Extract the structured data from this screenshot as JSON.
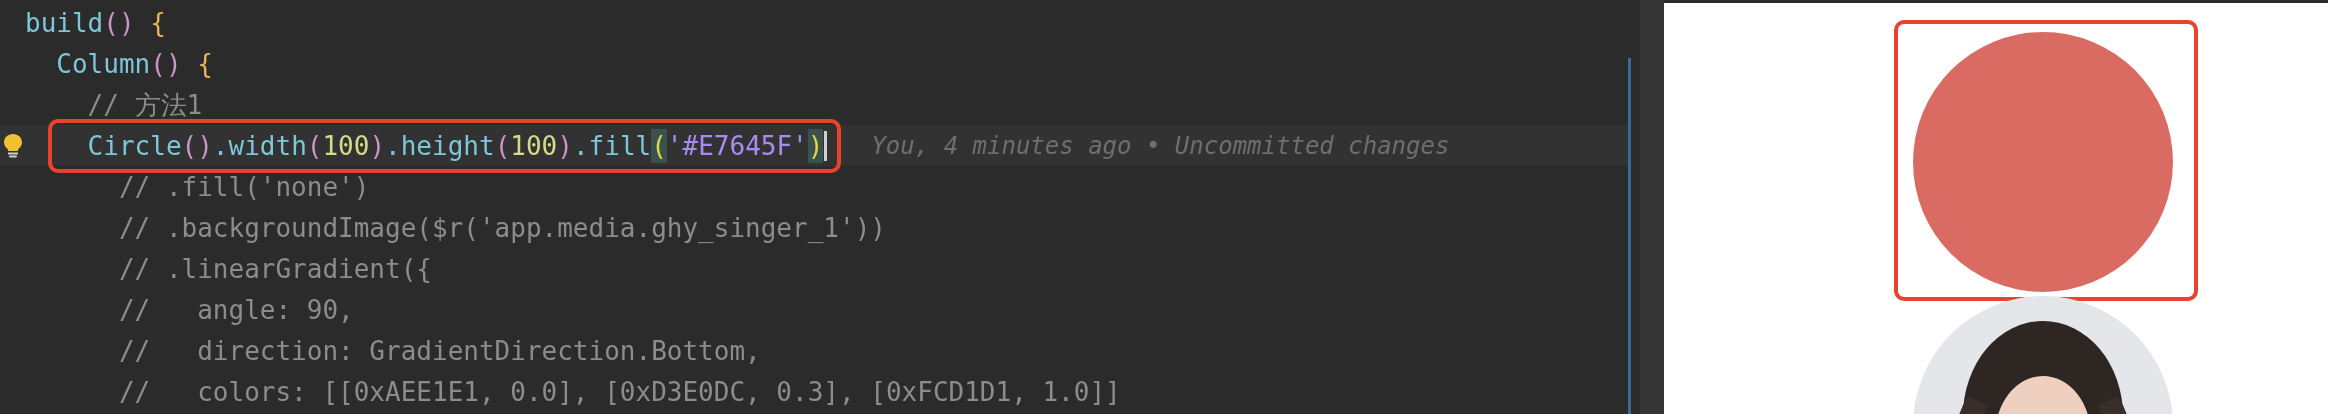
{
  "editor": {
    "lines": [
      {
        "current": false,
        "marked": false,
        "tokens": [
          {
            "kind": "ident",
            "text": "build"
          },
          {
            "kind": "paren",
            "text": "()"
          },
          {
            "kind": "brace",
            "text": " {"
          }
        ]
      },
      {
        "current": false,
        "marked": false,
        "tokens": [
          {
            "kind": "ident",
            "text": "  Column"
          },
          {
            "kind": "paren",
            "text": "()"
          },
          {
            "kind": "brace",
            "text": " {"
          }
        ]
      },
      {
        "current": false,
        "marked": false,
        "tokens": [
          {
            "kind": "comment",
            "text": "    // 方法1"
          }
        ]
      },
      {
        "current": true,
        "marked": true,
        "blame": "You, 4 minutes ago • Uncommitted changes",
        "tokens": [
          {
            "kind": "ident",
            "text": "    Circle"
          },
          {
            "kind": "paren",
            "text": "()"
          },
          {
            "kind": "ident",
            "text": ".width"
          },
          {
            "kind": "paren",
            "text": "("
          },
          {
            "kind": "number",
            "text": "100"
          },
          {
            "kind": "paren",
            "text": ")"
          },
          {
            "kind": "ident",
            "text": ".height"
          },
          {
            "kind": "paren",
            "text": "("
          },
          {
            "kind": "number",
            "text": "100"
          },
          {
            "kind": "paren",
            "text": ")"
          },
          {
            "kind": "ident",
            "text": ".fill"
          },
          {
            "kind": "match",
            "text": "("
          },
          {
            "kind": "string",
            "text": "'#E7645F'"
          },
          {
            "kind": "match",
            "text": ")"
          }
        ]
      },
      {
        "current": false,
        "marked": false,
        "tokens": [
          {
            "kind": "comment",
            "text": "      // .fill('none')"
          }
        ]
      },
      {
        "current": false,
        "marked": false,
        "tokens": [
          {
            "kind": "comment",
            "text": "      // .backgroundImage($r('app.media.ghy_singer_1'))"
          }
        ]
      },
      {
        "current": false,
        "marked": false,
        "tokens": [
          {
            "kind": "comment",
            "text": "      // .linearGradient({"
          }
        ]
      },
      {
        "current": false,
        "marked": false,
        "tokens": [
          {
            "kind": "comment",
            "text": "      //   angle: 90,"
          }
        ]
      },
      {
        "current": false,
        "marked": false,
        "tokens": [
          {
            "kind": "comment",
            "text": "      //   direction: GradientDirection.Bottom,"
          }
        ]
      },
      {
        "current": false,
        "marked": false,
        "tokens": [
          {
            "kind": "comment",
            "text": "      //   colors: [[0xAEE1E1, 0.0], [0xD3E0DC, 0.3], [0xFCD1D1, 1.0]]"
          }
        ]
      }
    ]
  },
  "preview": {
    "items": [
      {
        "kind": "circle",
        "marked": true
      },
      {
        "kind": "picture",
        "marked": false
      }
    ]
  }
}
